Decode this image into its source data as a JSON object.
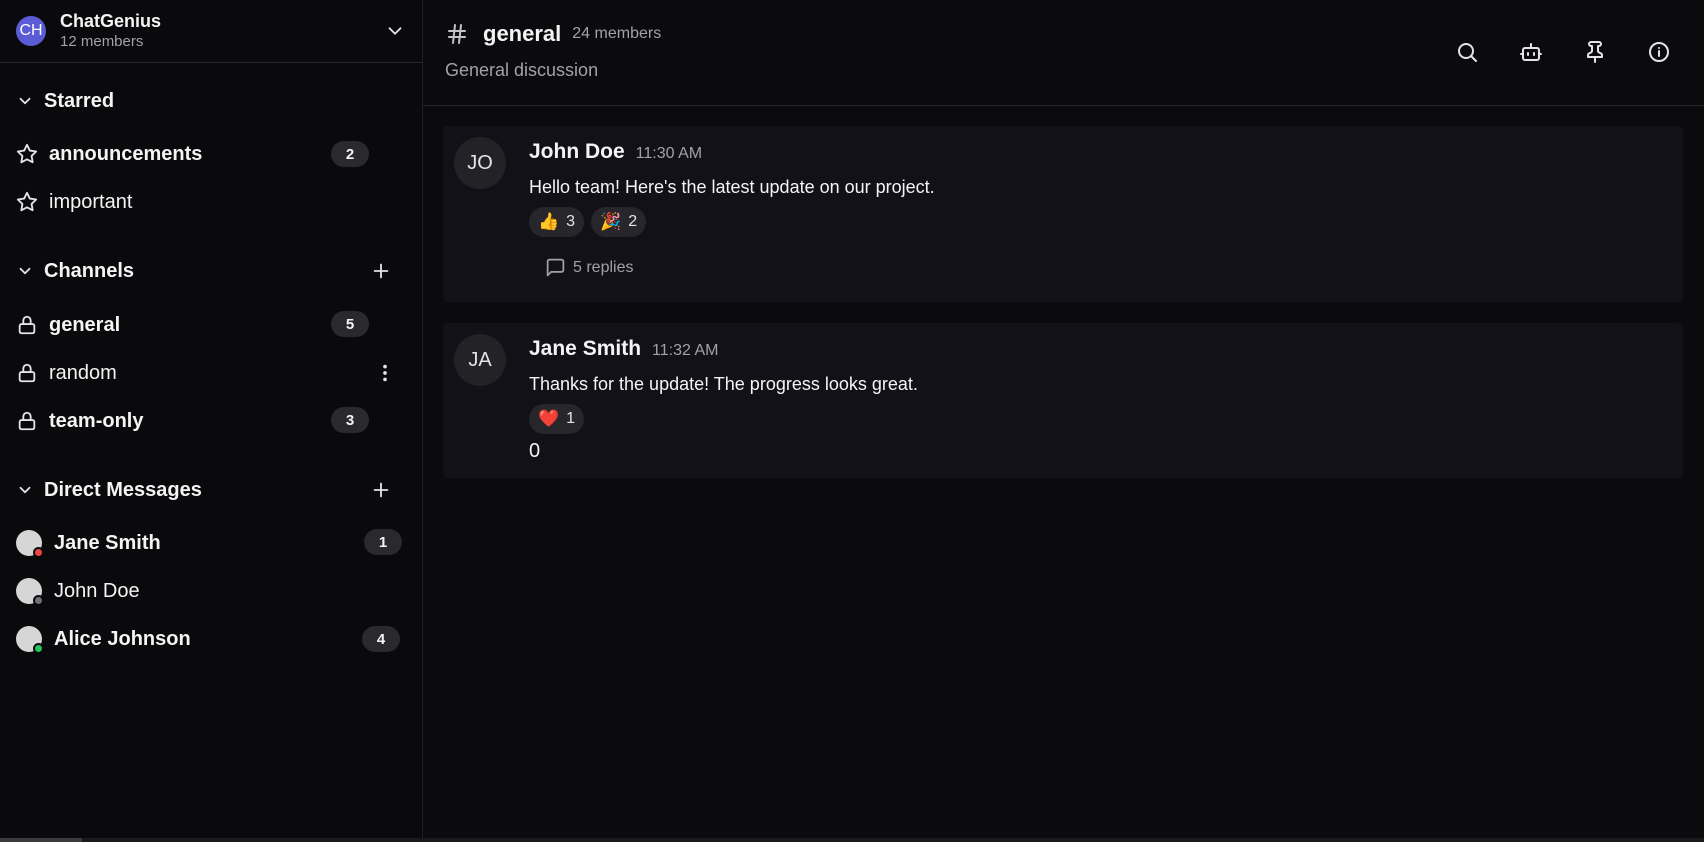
{
  "workspace": {
    "initials": "CH",
    "name": "ChatGenius",
    "members": "12 members"
  },
  "sidebar": {
    "starred": {
      "title": "Starred",
      "items": [
        {
          "label": "announcements",
          "badge": "2",
          "bold": true
        },
        {
          "label": "important",
          "badge": "",
          "bold": false
        }
      ]
    },
    "channels": {
      "title": "Channels",
      "items": [
        {
          "label": "general",
          "badge": "5",
          "bold": true
        },
        {
          "label": "random",
          "badge": "",
          "bold": false
        },
        {
          "label": "team-only",
          "badge": "3",
          "bold": true
        }
      ]
    },
    "dms": {
      "title": "Direct Messages",
      "items": [
        {
          "label": "Jane Smith",
          "badge": "1",
          "status_color": "#ef4444"
        },
        {
          "label": "John Doe",
          "badge": "",
          "status_color": "#71717a"
        },
        {
          "label": "Alice Johnson",
          "badge": "4",
          "status_color": "#22c55e"
        }
      ]
    }
  },
  "channel": {
    "name": "general",
    "members": "24 members",
    "topic": "General discussion",
    "icons": [
      "search-icon",
      "bot-icon",
      "pin-icon",
      "info-icon"
    ]
  },
  "messages": [
    {
      "initials": "JO",
      "author": "John Doe",
      "time": "11:30 AM",
      "text": "Hello team! Here's the latest update on our project.",
      "reactions": [
        {
          "emoji": "👍",
          "count": "3"
        },
        {
          "emoji": "🎉",
          "count": "2"
        }
      ],
      "replies": "5 replies"
    },
    {
      "initials": "JA",
      "author": "Jane Smith",
      "time": "11:32 AM",
      "text": "Thanks for the update! The progress looks great.",
      "reactions": [
        {
          "emoji": "❤️",
          "count": "1"
        }
      ],
      "reply_count": "0"
    }
  ],
  "colors": {
    "accent": "#5b5bd6",
    "background": "#0b0b0e",
    "message_bg": "#111117"
  }
}
